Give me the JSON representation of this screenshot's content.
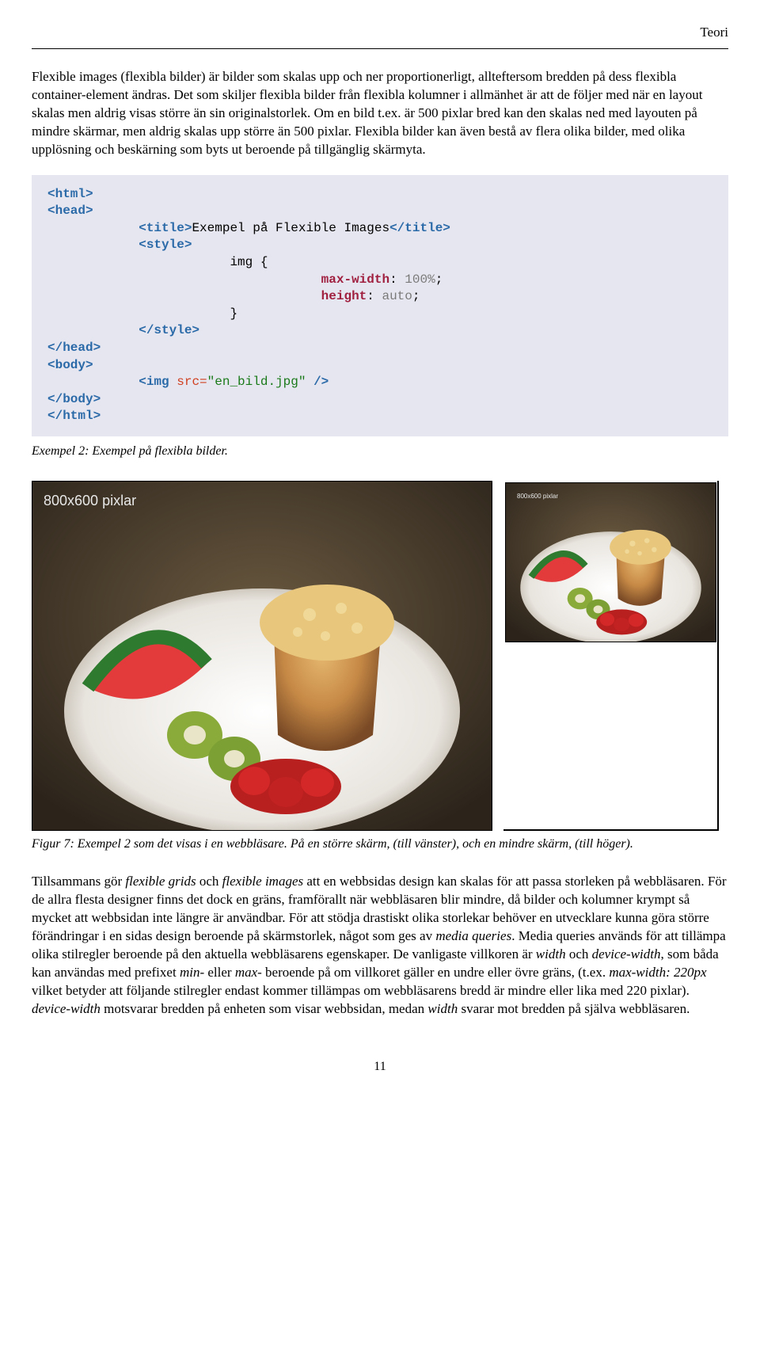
{
  "header_right": "Teori",
  "para1_a": "Flexible images (flexibla bilder) är bilder som skalas upp och ner proportionerligt, allteftersom bredden på dess flexibla container-element ändras. Det som skiljer flexibla bilder från flexibla kolumner i allmänhet är att de följer med när en layout skalas men aldrig visas större än sin originalstorlek. Om en bild t.ex. är 500 pixlar bred kan den skalas ned med layouten på mindre skärmar, men aldrig skalas upp större än 500 pixlar. Flexibla bilder kan även bestå av flera olika bilder, med olika upplösning och beskärning som byts ut beroende på tillgänglig skärmyta.",
  "code": {
    "title_text": "Exempel på Flexible Images",
    "css_prop1": "max-width",
    "css_val1": "100%",
    "css_prop2": "height",
    "css_val2": "auto",
    "img_src": "\"en_bild.jpg\""
  },
  "caption1": "Exempel 2: Exempel på flexibla bilder.",
  "fig_label_large": "800x600 pixlar",
  "fig_label_small": "800x600 pixlar",
  "caption2": "Figur 7: Exempel 2 som det visas i en webbläsare. På en större skärm, (till vänster), och en mindre skärm, (till höger).",
  "para2_before_fg": "Tillsammans gör ",
  "para2_fg": "flexible grids",
  "para2_mid1": " och ",
  "para2_fi": "flexible images",
  "para2_after1": " att en webbsidas design kan skalas för att passa storleken på webbläsaren. För de allra flesta designer finns det dock en gräns, framförallt när webbläsaren blir mindre, då bilder och kolumner krympt så mycket att webbsidan inte längre är användbar. För att stödja drastiskt olika storlekar behöver en utvecklare kunna göra större förändringar i en sidas design beroende på skärmstorlek, något som ges av ",
  "para2_mq": "media queries",
  "para2_after2": ". Media queries används för att tillämpa olika stilregler beroende på den aktuella webbläsarens egenskaper. De vanligaste villkoren är ",
  "para2_width": "width",
  "para2_and": " och ",
  "para2_dw": "device-width",
  "para2_after3": ", som båda kan användas med prefixet ",
  "para2_min": "min-",
  "para2_or": " eller ",
  "para2_max": "max-",
  "para2_after4": " beroende på om villkoret gäller en undre eller övre gräns, (t.ex. ",
  "para2_mw": "max-width: 220px",
  "para2_after5": " vilket betyder att följande stilregler endast kommer tillämpas om webbläsarens bredd är mindre eller lika med 220 pixlar). ",
  "para2_dw2": "device-width",
  "para2_after6": " motsvarar bredden på enheten som visar webbsidan, medan ",
  "para2_w2": "width",
  "para2_after7": " svarar mot bredden på själva webbläsaren.",
  "pagenum": "11"
}
